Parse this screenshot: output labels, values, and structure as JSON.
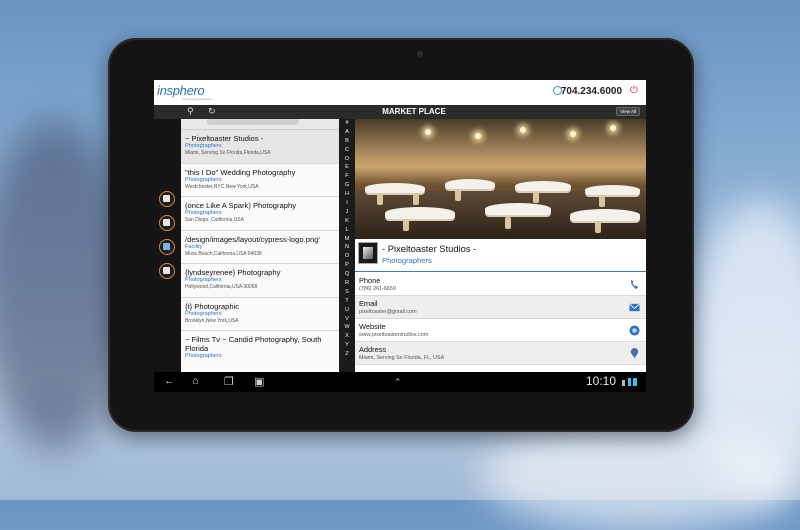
{
  "header": {
    "logo_text": "insphero",
    "logo_tagline": "connecting businesses",
    "phone": "704.234.6000"
  },
  "toolbar": {
    "title": "MARKET PLACE",
    "view_all_label": "View All"
  },
  "rail": {
    "items": [
      "home-icon",
      "gift-icon",
      "calendar-icon",
      "bag-icon"
    ]
  },
  "alphabet": {
    "hash": "#",
    "letters": [
      "A",
      "B",
      "C",
      "D",
      "E",
      "F",
      "G",
      "H",
      "I",
      "J",
      "K",
      "L",
      "M",
      "N",
      "O",
      "P",
      "Q",
      "R",
      "S",
      "T",
      "U",
      "V",
      "W",
      "X",
      "Y",
      "Z"
    ]
  },
  "list": {
    "items": [
      {
        "name": "~ Pixeltoaster Studios -",
        "category": "Photographers",
        "address": "Miami, Serving So Florida,Florida,USA"
      },
      {
        "name": "\"this I Do\" Wedding Photography",
        "category": "Photographers",
        "address": "Westchester,NYC,New York,USA"
      },
      {
        "name": "(once Like A Spark) Photography",
        "category": "Photographers",
        "address": "San Diego ,California,USA"
      },
      {
        "name": "/design/images/layout/cypress-logo.png'",
        "category": "Facility",
        "address": "Moss Beach,California,USA 94038"
      },
      {
        "name": "{lyndseyrenee} Photography",
        "category": "Photographers",
        "address": "Hollywood,California,USA 90068"
      },
      {
        "name": "{t} Photographic",
        "category": "Photographers",
        "address": "Brooklyn,New York,USA"
      },
      {
        "name": "~ Films Tv ~ Candid Photography, South Florida",
        "category": "Photographers",
        "address": ""
      }
    ]
  },
  "detail": {
    "name": "- Pixeltoaster Studios -",
    "category": "Photographers",
    "rows": [
      {
        "label": "Phone",
        "value": "(786) 261-6659"
      },
      {
        "label": "Email",
        "value": "pixeltoaster@gmail.com"
      },
      {
        "label": "Website",
        "value": "www.pixeltoasterstudios.com"
      },
      {
        "label": "Address",
        "value": "Miami, Serving So Florida, FL, USA"
      }
    ]
  },
  "status": {
    "time": "10:10"
  },
  "colors": {
    "accent": "#2f74c4",
    "rail_ring": "#e08a2c",
    "power": "#dd2222"
  }
}
